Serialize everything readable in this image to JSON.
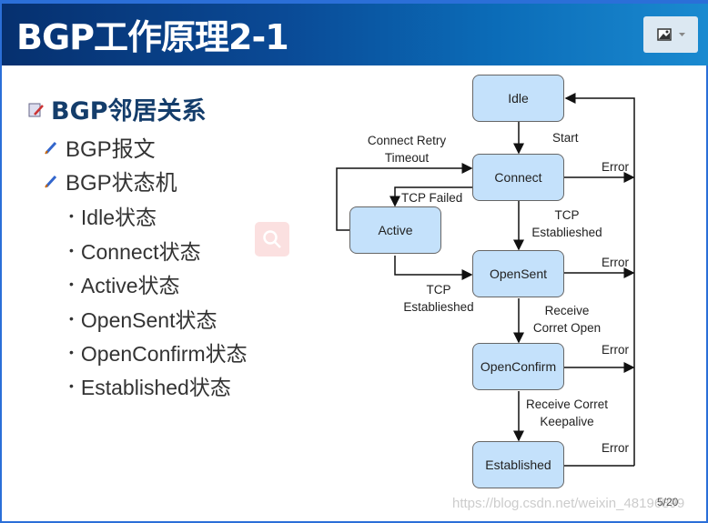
{
  "header": {
    "title": "BGP工作原理2-1",
    "image_button_icon": "image-icon",
    "dropdown_icon": "caret-down-icon"
  },
  "outline": {
    "heading": "BGP邻居关系",
    "items": [
      "BGP报文",
      "BGP状态机"
    ],
    "states": [
      "Idle状态",
      "Connect状态",
      "Active状态",
      "OpenSent状态",
      "OpenConfirm状态",
      "Established状态"
    ]
  },
  "diagram": {
    "states": {
      "idle": "Idle",
      "connect": "Connect",
      "active": "Active",
      "opensent": "OpenSent",
      "openconfirm": "OpenConfirm",
      "established": "Established"
    },
    "labels": {
      "start": "Start",
      "retry1": "Connect Retry",
      "retry2": "Timeout",
      "tcp_failed": "TCP Failed",
      "tcp_est_a1": "TCP",
      "tcp_est_a2": "Establieshed",
      "tcp_est_b1": "TCP",
      "tcp_est_b2": "Establieshed",
      "recv_open1": "Receive",
      "recv_open2": "Corret Open",
      "recv_ka1": "Receive Corret",
      "recv_ka2": "Keepalive",
      "error": "Error"
    }
  },
  "footer": {
    "page": "5/20",
    "watermark": "https://blog.csdn.net/weixin_48196899"
  },
  "colors": {
    "header": "#0a4a96",
    "state_fill": "#c4e1fb",
    "heading": "#143d6b"
  }
}
